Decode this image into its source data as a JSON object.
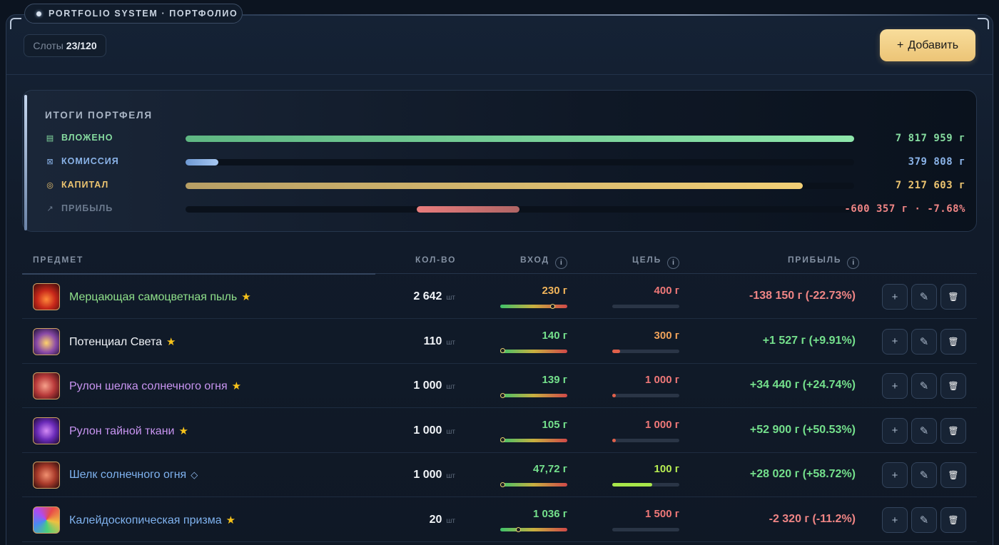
{
  "header": {
    "tag": "PORTFOLIO SYSTEM · ПОРТФОЛИО",
    "slots_label": "Слоты",
    "slots_value": "23/120",
    "add_label": "Добавить",
    "add_icon": "+"
  },
  "summary": {
    "title": "ИТОГИ ПОРТФЕЛЯ",
    "rows": [
      {
        "label": "ВЛОЖЕНО",
        "amount": "7 817 959 г",
        "fill": 1.0,
        "color": "#86dca0",
        "icon": "wallet-icon"
      },
      {
        "label": "КОМИССИЯ",
        "amount": "379 808 г",
        "fill": 0.049,
        "color": "#8ab3e8",
        "icon": "fee-icon"
      },
      {
        "label": "КАПИТАЛ",
        "amount": "7 217 603 г",
        "fill": 0.923,
        "color": "#ecc470",
        "icon": "capital-icon"
      },
      {
        "label": "ПРИБЫЛЬ",
        "amount": "-600 357 г · -7.68%",
        "fill": -0.0768,
        "color": "#ef8585",
        "icon": "trend-icon"
      }
    ]
  },
  "table": {
    "headers": {
      "item": "ПРЕДМЕТ",
      "qty": "КОЛ-ВО",
      "entry": "ВХОД",
      "target": "ЦЕЛЬ",
      "profit": "ПРИБЫЛЬ",
      "info": "i"
    },
    "unit": "шт",
    "rows": [
      {
        "name": "Мерцающая самоцветная пыль",
        "mark": "★",
        "qty": "2 642",
        "entry": "230 г",
        "entry_pos": 0.8,
        "target": "400 г",
        "target_fill": 0.0,
        "profit": "-138 150 г (-22.73%)",
        "name_color": "#8fe08a",
        "entry_color": "#f0b45a",
        "target_color": "#ef7878",
        "profit_color": "#ef8585"
      },
      {
        "name": "Потенциал Света",
        "mark": "★",
        "qty": "110",
        "entry": "140 г",
        "entry_pos": 0.0,
        "target": "300 г",
        "target_fill": 0.12,
        "profit": "+1 527 г (+9.91%)",
        "name_color": "#f1f4f8",
        "entry_color": "#74e08c",
        "target_color": "#f0a35a",
        "profit_color": "#74e08c"
      },
      {
        "name": "Рулон шелка солнечного огня",
        "mark": "★",
        "qty": "1 000",
        "entry": "139 г",
        "entry_pos": 0.0,
        "target": "1 000 г",
        "target_fill": 0.03,
        "profit": "+34 440 г (+24.74%)",
        "name_color": "#c995f2",
        "entry_color": "#74e08c",
        "target_color": "#ef7878",
        "profit_color": "#74e08c"
      },
      {
        "name": "Рулон тайной ткани",
        "mark": "★",
        "qty": "1 000",
        "entry": "105 г",
        "entry_pos": 0.0,
        "target": "1 000 г",
        "target_fill": 0.04,
        "profit": "+52 900 г (+50.53%)",
        "name_color": "#c995f2",
        "entry_color": "#74e08c",
        "target_color": "#ef7878",
        "profit_color": "#74e08c"
      },
      {
        "name": "Шелк солнечного огня",
        "mark": "◇",
        "qty": "1 000",
        "entry": "47,72 г",
        "entry_pos": 0.0,
        "target": "100 г",
        "target_fill": 0.6,
        "profit": "+28 020 г (+58.72%)",
        "name_color": "#7fb2ef",
        "entry_color": "#74e08c",
        "target_color": "#b8ee52",
        "profit_color": "#74e08c"
      },
      {
        "name": "Калейдоскопическая призма",
        "mark": "★",
        "qty": "20",
        "entry": "1 036 г",
        "entry_pos": 0.25,
        "target": "1 500 г",
        "target_fill": 0.0,
        "profit": "-2 320 г (-11.2%)",
        "name_color": "#7fb2ef",
        "entry_color": "#74e08c",
        "target_color": "#ef7878",
        "profit_color": "#ef8585"
      }
    ],
    "actions": {
      "add": "+",
      "edit": "✎",
      "delete": "🗑"
    }
  }
}
